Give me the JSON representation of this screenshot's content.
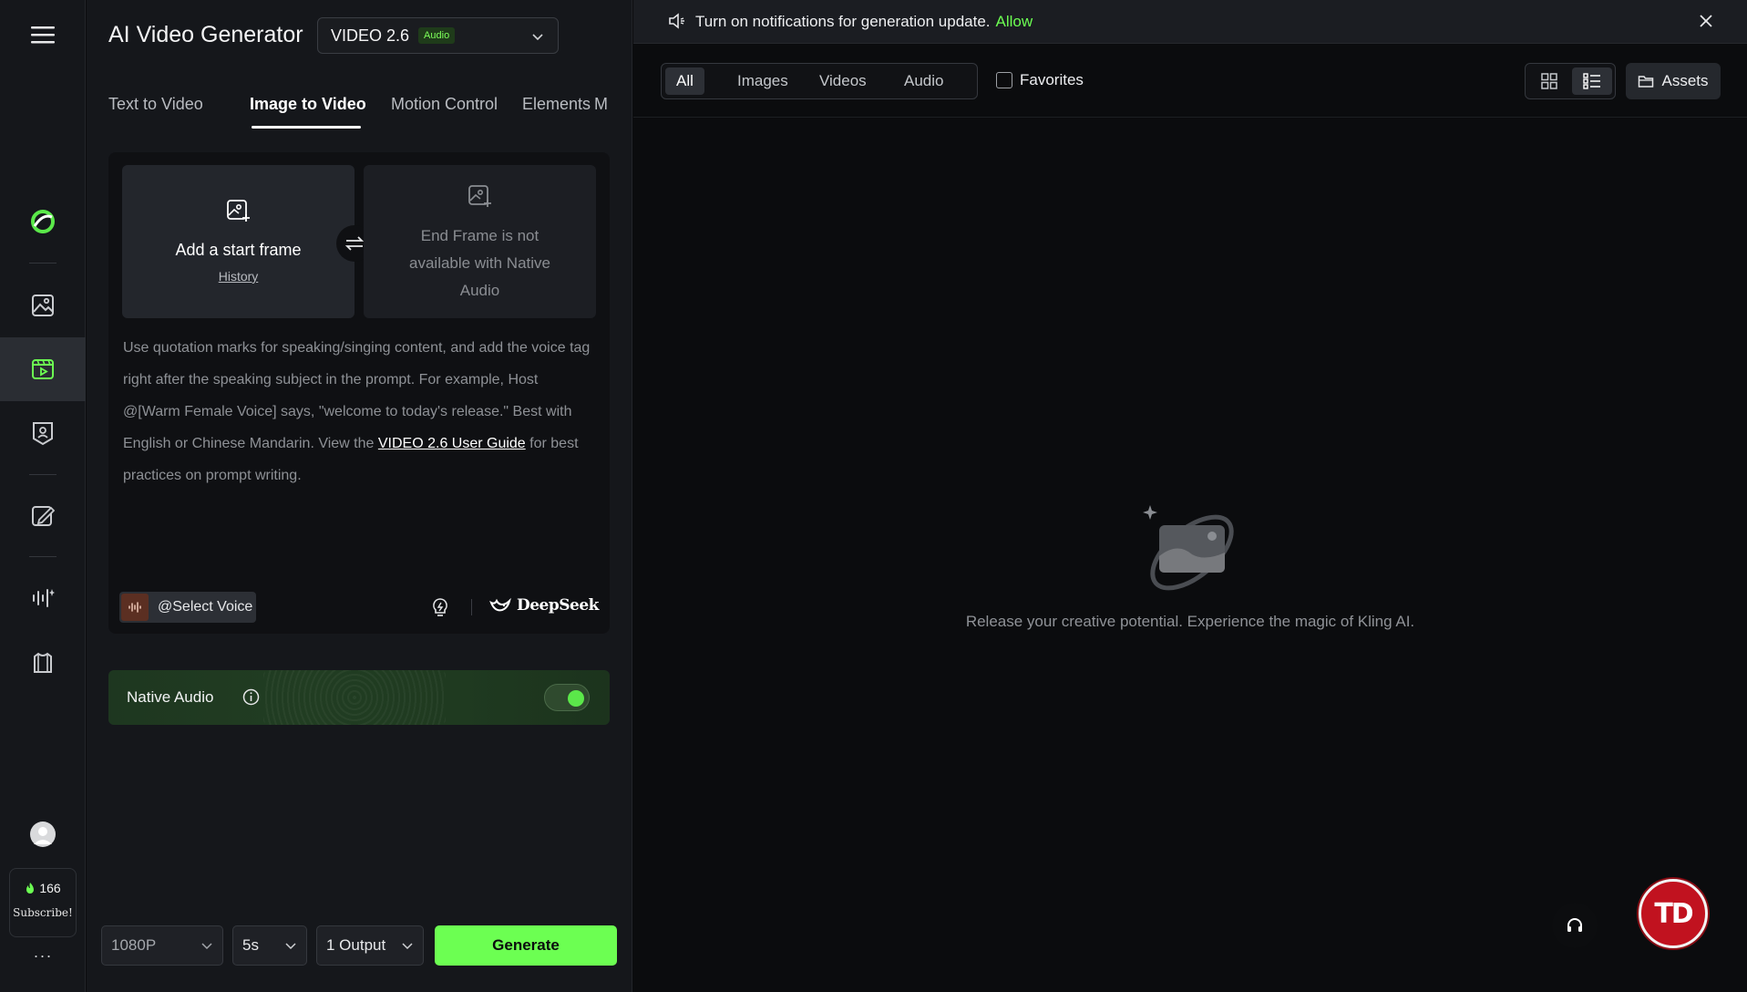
{
  "colors": {
    "accent": "#6cff52",
    "panel": "#15171b",
    "background": "#0b0c0e",
    "brand_badge": "#c1121f"
  },
  "rail": {
    "items": [
      {
        "name": "kling-logo-icon"
      },
      {
        "name": "image-icon"
      },
      {
        "name": "video-icon",
        "active": true
      },
      {
        "name": "avatar-studio-icon"
      },
      {
        "name": "edit-brush-icon"
      },
      {
        "name": "sound-wave-icon"
      },
      {
        "name": "shirt-icon"
      }
    ],
    "credits": {
      "amount": "166",
      "subscribe": "Subscribe!"
    },
    "more": "···"
  },
  "panel": {
    "title": "AI Video Generator",
    "model": {
      "name": "VIDEO 2.6",
      "badge": "Audio"
    },
    "tabs": [
      "Text to Video",
      "Image to Video",
      "Motion Control",
      "Elements",
      "Mu"
    ],
    "active_tab": "Image to Video",
    "start_frame": {
      "label": "Add a start frame",
      "history": "History"
    },
    "end_frame": {
      "label": "End Frame is not available with Native Audio"
    },
    "prompt": {
      "before_link": "Use quotation marks for speaking/singing content, and add the voice tag right after the speaking subject in the prompt. For example, Host @[Warm Female Voice] says, \"welcome to today's release.\" Best with English or Chinese Mandarin. View the ",
      "link": "VIDEO 2.6 User Guide",
      "after_link": " for best practices on prompt writing."
    },
    "voice_button": "@Select Voice",
    "deepseek": "DeepSeek",
    "native_audio": {
      "label": "Native Audio",
      "enabled": true
    },
    "bottom": {
      "resolution": "1080P",
      "duration": "5s",
      "outputs": "1 Output",
      "generate": "Generate"
    }
  },
  "notification": {
    "text": "Turn on notifications for generation update.",
    "action": "Allow"
  },
  "library": {
    "filters": [
      "All",
      "Images",
      "Videos",
      "Audio"
    ],
    "active_filter": "All",
    "favorites": "Favorites",
    "assets": "Assets",
    "empty_message": "Release your creative potential. Experience the magic of Kling AI."
  },
  "badge": {
    "text": "TD"
  }
}
